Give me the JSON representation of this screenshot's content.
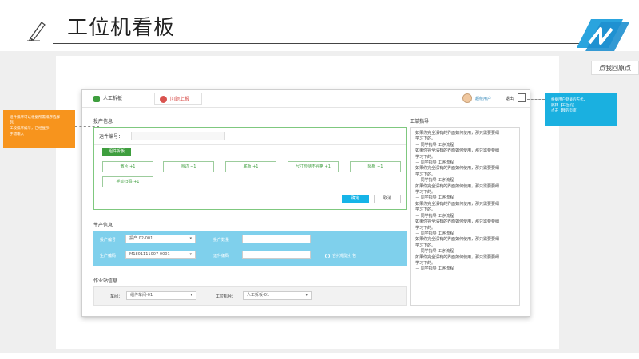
{
  "header": {
    "title": "工位机看板",
    "pencil_icon": "pencil-icon",
    "logo_icon": "brand-logo"
  },
  "restore_label": "点我回原点",
  "app": {
    "tab_manual": "人工拆板",
    "tab_issue": "问题上报",
    "user_name": "超级用户",
    "logout": "退出",
    "dispatch": {
      "section_title": "投产信息",
      "wo_label": "运件编号：",
      "green_btn": "组件拆板",
      "buttons": [
        "散片 +1",
        "围边 +1",
        "底板 +1",
        "尺寸检测不合格 +1",
        "隔板 +1",
        "手动扫码 +1"
      ],
      "confirm": "确定",
      "cancel": "取消"
    },
    "production": {
      "section_title": "生产信息",
      "label1": "投产编号",
      "value1": "投产 02-001",
      "label2": "投产数量",
      "label3": "生产编码",
      "value3": "M1801111007-0001",
      "label4": "运件编码",
      "check_label": "合托组建打包"
    },
    "station": {
      "section_title": "作业站信息",
      "label_workshop": "车间：",
      "value_workshop": "组件车间-01",
      "label_machine": "工位机台：",
      "value_machine": "人工拆板-01"
    },
    "work_order": {
      "title": "工单指导",
      "lines": [
        "如果你完全没有的界面如何使用，那只需要要细",
        "学习下的。",
        "－ 同学指导 工序流程",
        "如果你完全没有的界面如何使用，那只需要要细",
        "学习下的。",
        "－ 同学指导 工序流程",
        "如果你完全没有的界面如何使用，那只需要要细",
        "学习下的。",
        "－ 同学指导 工序流程",
        "如果你完全没有的界面如何使用，那只需要要细",
        "学习下的。",
        "－ 同学指导 工序流程",
        "如果你完全没有的界面如何使用，那只需要要细",
        "学习下的。",
        "－ 同学指导 工序流程",
        "如果你完全没有的界面如何使用，那只需要要细",
        "学习下的。",
        "－ 同学指导 工序流程",
        "如果你完全没有的界面如何使用，那只需要要细",
        "学习下的。",
        "－ 同学指导 工序流程",
        "如果你完全没有的界面如何使用，那只需要要细",
        "学习下的。",
        "－ 同学指导 工序流程"
      ]
    }
  },
  "callout_left": {
    "lines": [
      "组件排序可以根据所需排序选择",
      "列。",
      "工段排序编号，已经显示，",
      "手动输入"
    ]
  },
  "callout_right": {
    "lines": [
      "根据用户登录的方式，",
      "跳转【工位机】",
      "点击【我的页面】"
    ]
  },
  "colors": {
    "accent_blue": "#16b4e8",
    "accent_green": "#3e9e3e",
    "callout_orange": "#f7941d",
    "production_band": "#7fd0ec"
  }
}
